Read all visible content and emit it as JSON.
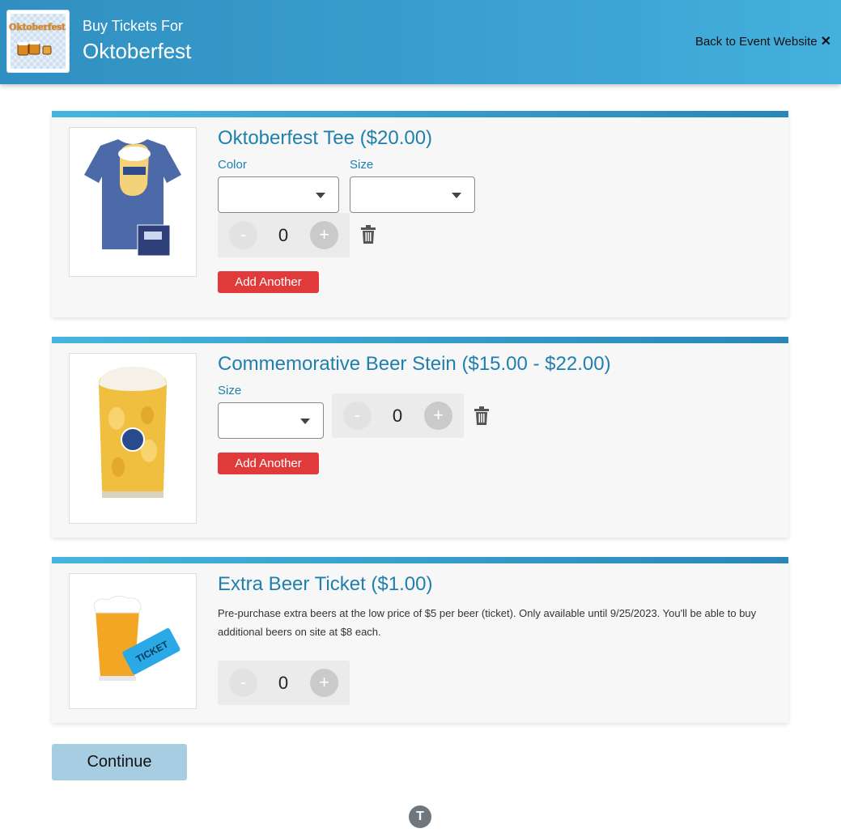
{
  "header": {
    "subtitle": "Buy Tickets For",
    "title": "Oktoberfest",
    "logo_text": "Oktoberfest",
    "back_link": "Back to Event Website",
    "close_glyph": "✕"
  },
  "products": [
    {
      "title": "Oktoberfest Tee ($20.00)",
      "fields": [
        {
          "label": "Color",
          "value": ""
        },
        {
          "label": "Size",
          "value": ""
        }
      ],
      "quantity": "0",
      "minus": "-",
      "plus": "+",
      "add_another": "Add Another",
      "image_icon": "tshirt-icon"
    },
    {
      "title": "Commemorative Beer Stein ($15.00 - $22.00)",
      "fields": [
        {
          "label": "Size",
          "value": ""
        }
      ],
      "quantity": "0",
      "minus": "-",
      "plus": "+",
      "add_another": "Add Another",
      "image_icon": "beer-stein-icon"
    },
    {
      "title": "Extra Beer Ticket ($1.00)",
      "description": "Pre-purchase extra beers at the low price of $5 per beer (ticket). Only available until 9/25/2023. You'll be able to buy additional beers on site at $8 each.",
      "quantity": "0",
      "minus": "-",
      "plus": "+",
      "image_icon": "beer-ticket-icon",
      "ticket_text": "TICKET"
    }
  ],
  "continue_label": "Continue",
  "footer_logo": "T",
  "colors": {
    "accent": "#2f8fc0",
    "title_blue": "#1f7fae",
    "add_button": "#e03a3a",
    "continue_button": "#a7cde2"
  }
}
